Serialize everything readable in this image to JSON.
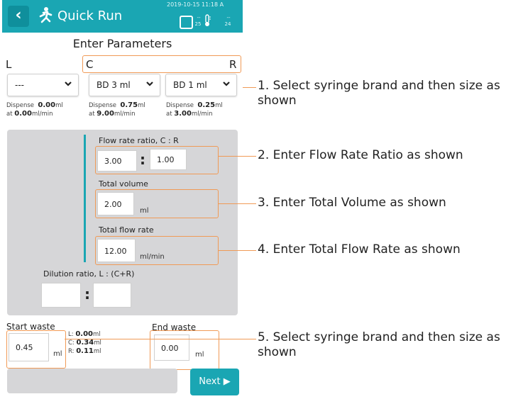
{
  "header": {
    "title": "Quick Run",
    "datetime": "2019-10-15 11:18 A",
    "status_top_1": "--",
    "status_val_1": "25",
    "status_top_2": "--",
    "status_val_2": "24",
    "accent_color": "#1aa6b3"
  },
  "section_title": "Enter Parameters",
  "columns": {
    "left": "L",
    "center": "C",
    "right": "R"
  },
  "syringes": [
    {
      "value": "---",
      "dispense_label": "Dispense",
      "dispense_value": "0.00",
      "dispense_unit": "ml",
      "at_label": "at",
      "rate_value": "0.00",
      "rate_unit": "ml/min"
    },
    {
      "value": "BD 3 ml",
      "dispense_label": "Dispense",
      "dispense_value": "0.75",
      "dispense_unit": "ml",
      "at_label": "at",
      "rate_value": "9.00",
      "rate_unit": "ml/min"
    },
    {
      "value": "BD 1 ml",
      "dispense_label": "Dispense",
      "dispense_value": "0.25",
      "dispense_unit": "ml",
      "at_label": "at",
      "rate_value": "3.00",
      "rate_unit": "ml/min"
    }
  ],
  "params": {
    "flow_ratio_label": "Flow rate ratio, C : R",
    "flow_ratio_c": "3.00",
    "flow_ratio_sep": ":",
    "flow_ratio_r": "1.00",
    "total_volume_label": "Total volume",
    "total_volume_value": "2.00",
    "total_volume_unit": "ml",
    "total_flow_label": "Total flow rate",
    "total_flow_value": "12.00",
    "total_flow_unit": "ml/min",
    "dilution_label": "Dilution ratio, L : (C+R)",
    "dilution_left": "",
    "dilution_sep": ":",
    "dilution_right": ""
  },
  "waste": {
    "start_label": "Start waste",
    "start_value": "0.45",
    "start_unit": "ml",
    "breakdown": [
      {
        "key": "L:",
        "value": "0.00",
        "unit": "ml"
      },
      {
        "key": "C:",
        "value": "0.34",
        "unit": "ml"
      },
      {
        "key": "R:",
        "value": "0.11",
        "unit": "ml"
      }
    ],
    "end_label": "End waste",
    "end_value": "0.00",
    "end_unit": "ml"
  },
  "next_label": "Next ▶",
  "annotations": {
    "a1_line1": "1. Select syringe brand and then size as",
    "a1_line2": "shown",
    "a2": "2. Enter Flow Rate Ratio as shown",
    "a3": "3. Enter Total Volume as shown",
    "a4": "4. Enter Total Flow Rate as shown",
    "a5_line1": "5. Select syringe brand and then size as",
    "a5_line2": "shown",
    "highlight_color": "#f09a56"
  }
}
